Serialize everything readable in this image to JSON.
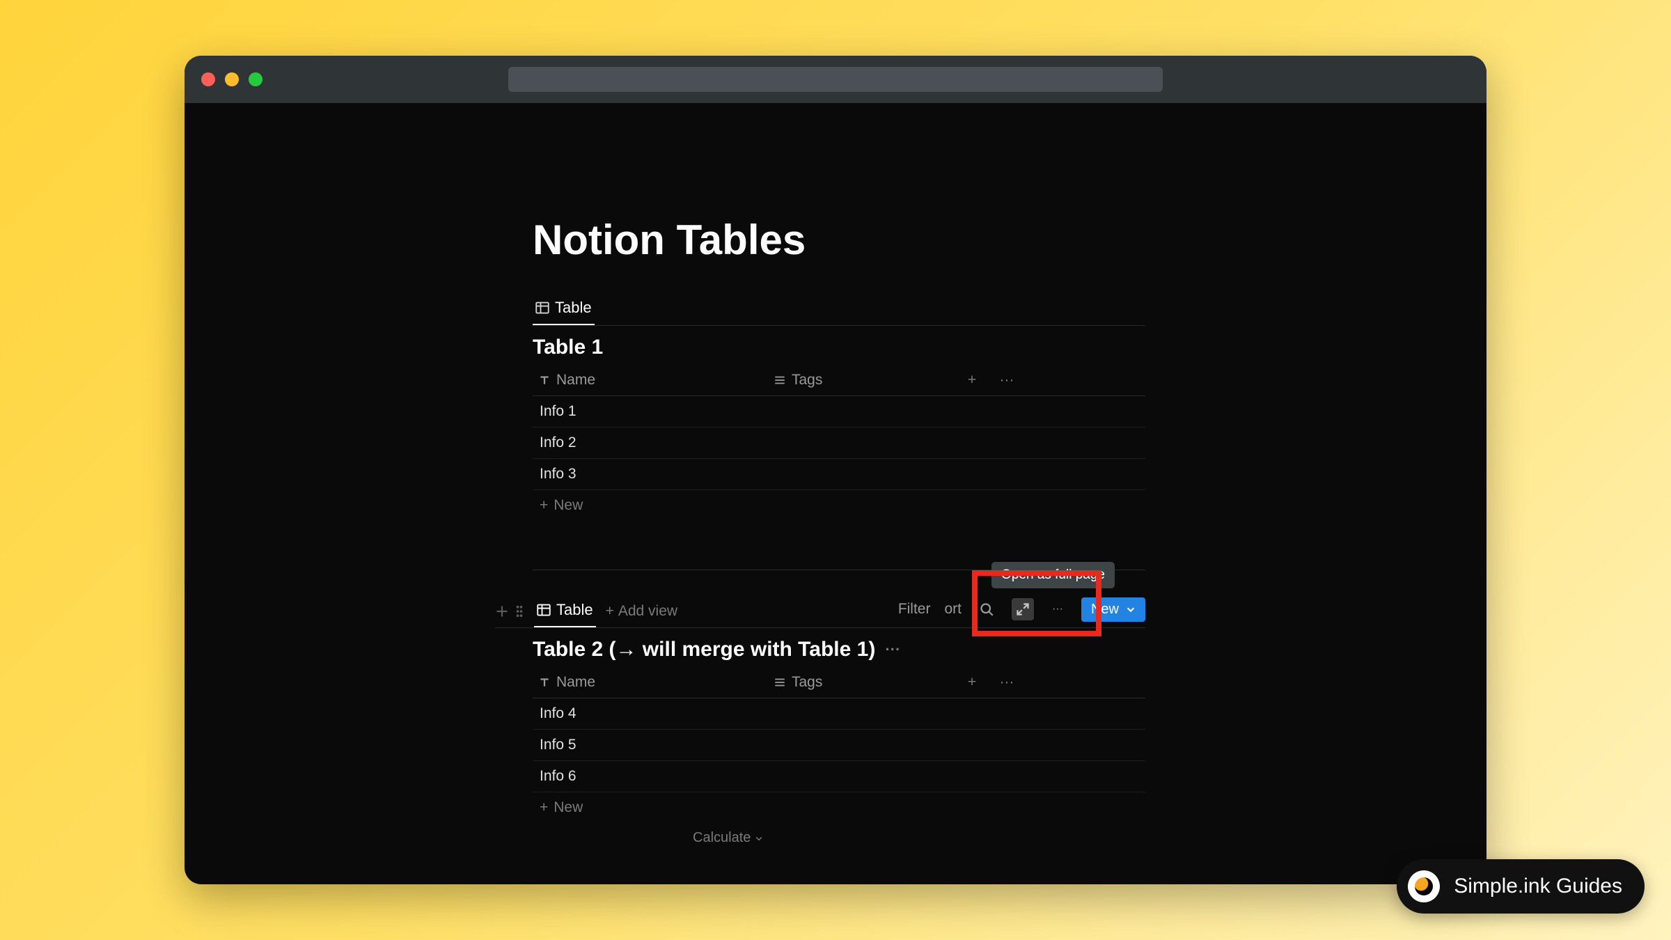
{
  "page": {
    "title": "Notion Tables"
  },
  "db1": {
    "tab_label": "Table",
    "title": "Table  1",
    "columns": {
      "name": "Name",
      "tags": "Tags"
    },
    "rows": [
      "Info 1",
      "Info 2",
      "Info 3"
    ],
    "new_label": "New"
  },
  "db2": {
    "tab_label": "Table",
    "add_view_label": "Add view",
    "title": "Table 2   (→ will merge with Table 1)",
    "columns": {
      "name": "Name",
      "tags": "Tags"
    },
    "rows": [
      "Info 4",
      "Info 5",
      "Info 6"
    ],
    "new_label": "New",
    "calculate_label": "Calculate",
    "toolbar": {
      "filter": "Filter",
      "sort": "ort",
      "new": "New",
      "tooltip": "Open as full page"
    }
  },
  "badge": {
    "text": "Simple.ink Guides"
  }
}
